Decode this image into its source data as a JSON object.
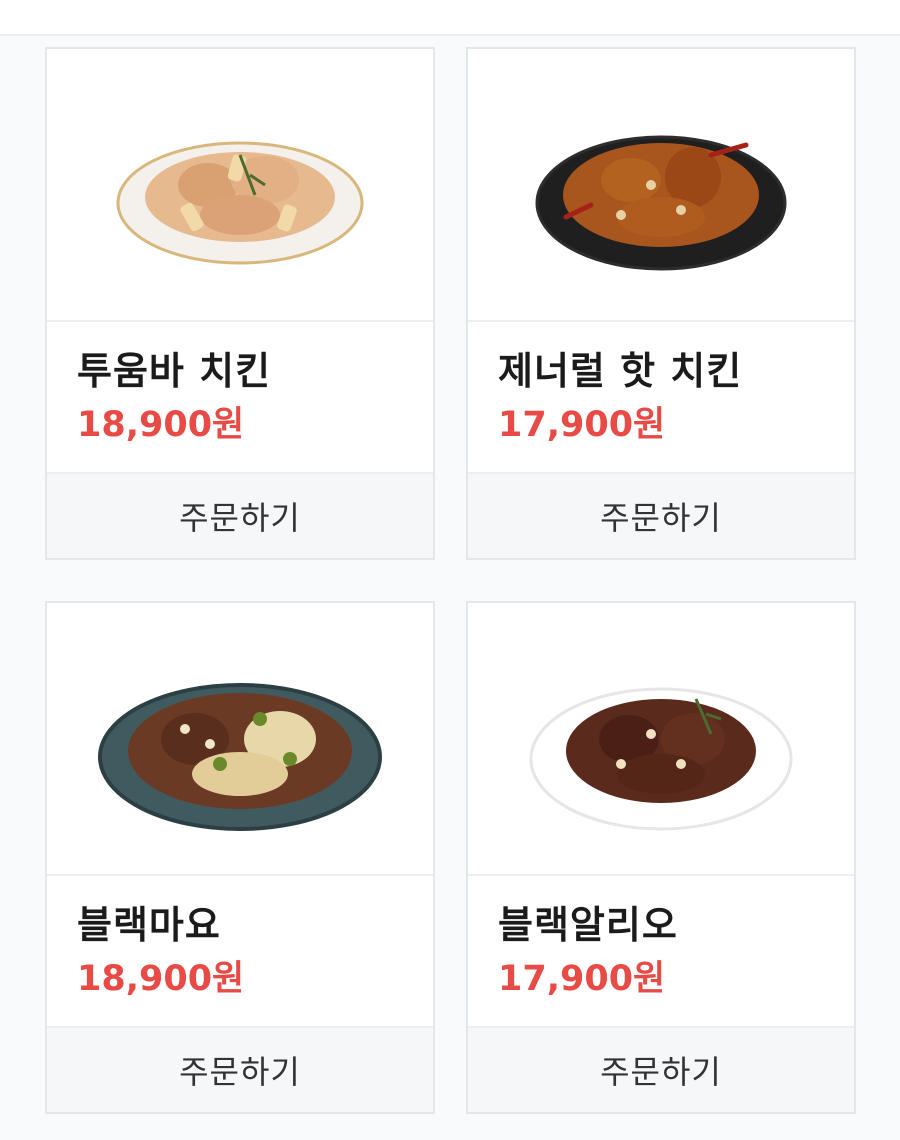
{
  "products": [
    {
      "name": "투움바 치킨",
      "price": "18,900원",
      "order_label": "주문하기",
      "image": "creamy-chicken-plate",
      "plate_color": "#f4f1ec",
      "plate_rim": "#d9b77c",
      "food_color": "#e7b98f"
    },
    {
      "name": "제너럴 핫 치킨",
      "price": "17,900원",
      "order_label": "주문하기",
      "image": "spicy-chicken-plate",
      "plate_color": "#1f1f1f",
      "plate_rim": "#2d2d2d",
      "food_color": "#a8551e"
    },
    {
      "name": "블랙마요",
      "price": "18,900원",
      "order_label": "주문하기",
      "image": "mayo-jalapeno-chicken-plate",
      "plate_color": "#3f5b60",
      "plate_rim": "#2c3f43",
      "food_color": "#6b3a24"
    },
    {
      "name": "블랙알리오",
      "price": "17,900원",
      "order_label": "주문하기",
      "image": "garlic-soy-chicken-plate",
      "plate_color": "#ffffff",
      "plate_rim": "#e6e6e6",
      "food_color": "#5a2a1c"
    }
  ]
}
